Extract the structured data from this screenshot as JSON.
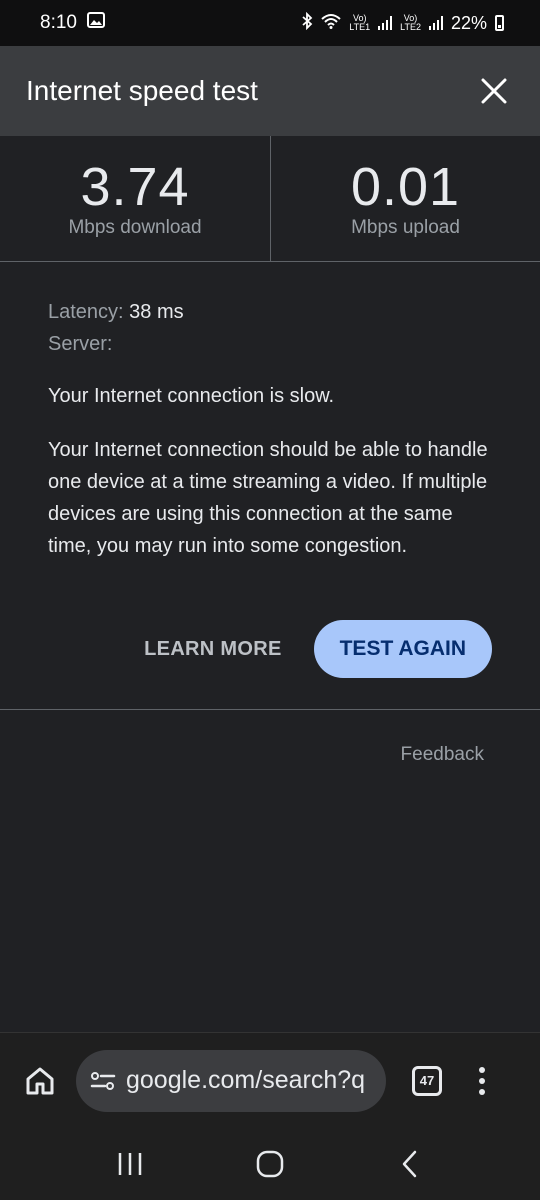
{
  "status_bar": {
    "time": "8:10",
    "lte1": "LTE1",
    "lte2": "LTE2",
    "volte1": "Vo)",
    "volte2": "Vo)",
    "battery": "22%"
  },
  "dialog": {
    "title": "Internet speed test",
    "download": {
      "value": "3.74",
      "label": "Mbps download"
    },
    "upload": {
      "value": "0.01",
      "label": "Mbps upload"
    },
    "latency_label": "Latency:",
    "latency_value": "38 ms",
    "server_label": "Server:",
    "summary": "Your Internet connection is slow.",
    "description": "Your Internet connection should be able to handle one device at a time streaming a video. If multiple devices are using this connection at the same time, you may run into some congestion.",
    "learn_more": "LEARN MORE",
    "test_again": "TEST AGAIN",
    "feedback": "Feedback"
  },
  "browser": {
    "url": "google.com/search?q",
    "tab_count": "47"
  },
  "colors": {
    "background": "#202124",
    "header": "#3b3d40",
    "accent_button": "#a8c7fa"
  }
}
